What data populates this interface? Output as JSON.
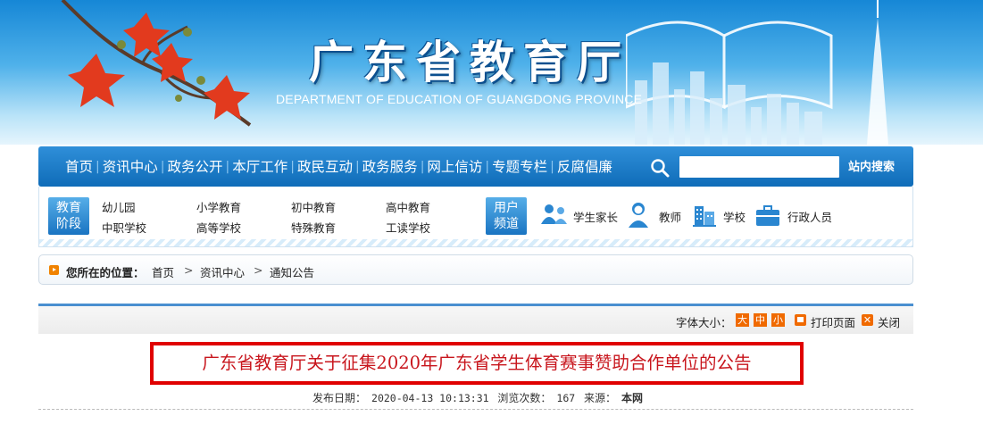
{
  "header": {
    "title": "广东省教育厅",
    "subtitle": "DEPARTMENT OF EDUCATION OF GUANGDONG PROVINCE"
  },
  "main_nav": {
    "items": [
      "首页",
      "资讯中心",
      "政务公开",
      "本厅工作",
      "政民互动",
      "政务服务",
      "网上信访",
      "专题专栏",
      "反腐倡廉"
    ],
    "search_placeholder": "",
    "search_button": "站内搜索"
  },
  "sub_nav": {
    "stage_tag": [
      "教育",
      "阶段"
    ],
    "stages": [
      "幼儿园",
      "小学教育",
      "初中教育",
      "高中教育",
      "中职学校",
      "高等学校",
      "特殊教育",
      "工读学校"
    ],
    "user_tag": [
      "用户",
      "频道"
    ],
    "users": [
      "学生家长",
      "教师",
      "学校",
      "行政人员"
    ]
  },
  "breadcrumb": {
    "label": "您所在的位置：",
    "items": [
      "首页",
      "资讯中心",
      "通知公告"
    ],
    "separator": ">"
  },
  "toolbar": {
    "font_size_label": "字体大小：",
    "sizes": [
      "大",
      "中",
      "小"
    ],
    "print": "打印页面",
    "close": "关闭"
  },
  "article": {
    "title": "广东省教育厅关于征集2020年广东省学生体育赛事赞助合作单位的公告",
    "publish_label": "发布日期：",
    "publish_date": "2020-04-13 10:13:31",
    "views_label": "浏览次数：",
    "views": "167",
    "source_label": "来源：",
    "source": "本网"
  },
  "colors": {
    "nav_blue": "#0f6cb8",
    "accent_orange": "#f06a00",
    "title_red": "#c8161d",
    "highlight_box": "#e00000"
  }
}
